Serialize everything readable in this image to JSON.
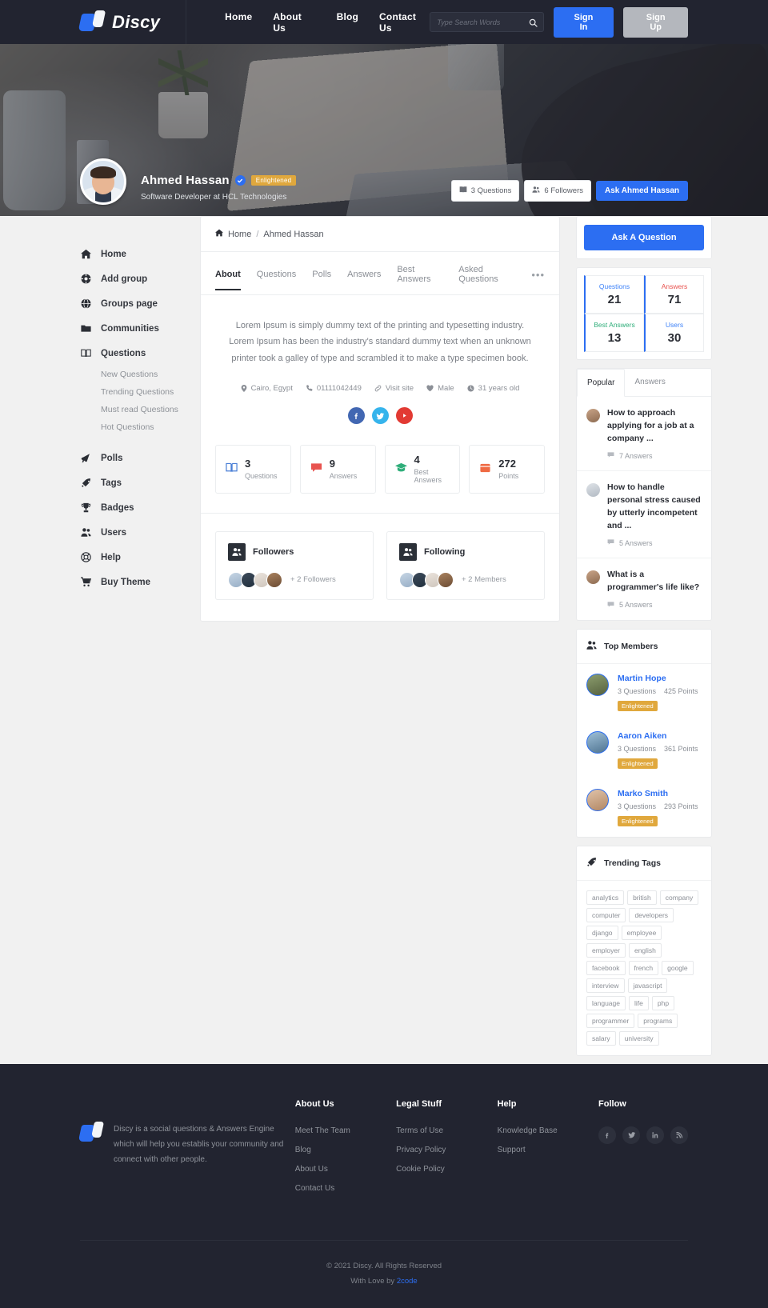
{
  "header": {
    "brand": "Discy",
    "nav": [
      {
        "label": "Home"
      },
      {
        "label": "About Us"
      },
      {
        "label": "Blog"
      },
      {
        "label": "Contact Us"
      }
    ],
    "search_placeholder": "Type Search Words",
    "search_value": "",
    "sign_in": "Sign In",
    "sign_up": "Sign Up"
  },
  "hero": {
    "name": "Ahmed Hassan",
    "badge": "Enlightened",
    "subtitle": "Software Developer at HCL Technologies",
    "questions_pill": "3 Questions",
    "followers_pill": "6 Followers",
    "ask_button": "Ask Ahmed Hassan"
  },
  "sidebar": {
    "items": [
      {
        "label": "Home",
        "icon": "home-icon"
      },
      {
        "label": "Add group",
        "icon": "add-group-icon"
      },
      {
        "label": "Groups page",
        "icon": "globe-icon"
      },
      {
        "label": "Communities",
        "icon": "folder-icon"
      },
      {
        "label": "Questions",
        "icon": "book-icon"
      }
    ],
    "question_subitems": [
      {
        "label": "New Questions"
      },
      {
        "label": "Trending Questions"
      },
      {
        "label": "Must read Questions"
      },
      {
        "label": "Hot Questions"
      }
    ],
    "items2": [
      {
        "label": "Polls",
        "icon": "megaphone-icon"
      },
      {
        "label": "Tags",
        "icon": "tag-icon"
      },
      {
        "label": "Badges",
        "icon": "trophy-icon"
      },
      {
        "label": "Users",
        "icon": "users-icon"
      },
      {
        "label": "Help",
        "icon": "lifebuoy-icon"
      },
      {
        "label": "Buy Theme",
        "icon": "cart-icon"
      }
    ]
  },
  "main": {
    "breadcrumb": {
      "home": "Home",
      "separator": "/",
      "current": "Ahmed Hassan"
    },
    "tabs": [
      {
        "label": "About",
        "active": true
      },
      {
        "label": "Questions",
        "active": false
      },
      {
        "label": "Polls",
        "active": false
      },
      {
        "label": "Answers",
        "active": false
      },
      {
        "label": "Best Answers",
        "active": false
      },
      {
        "label": "Asked Questions",
        "active": false
      }
    ],
    "tabs_more": "•••",
    "bio": "Lorem Ipsum is simply dummy text of the printing and typesetting industry. Lorem Ipsum has been the industry's standard dummy text when an unknown printer took a galley of type and scrambled it to make a type specimen book.",
    "meta": [
      {
        "icon": "location-pin-icon",
        "label": "Cairo, Egypt"
      },
      {
        "icon": "phone-icon",
        "label": "01111042449"
      },
      {
        "icon": "link-icon",
        "label": "Visit site"
      },
      {
        "icon": "heart-icon",
        "label": "Male"
      },
      {
        "icon": "clock-icon",
        "label": "31 years old"
      }
    ],
    "socials": [
      {
        "name": "facebook-icon",
        "color": "#4267b2"
      },
      {
        "name": "twitter-icon",
        "color": "#36b4ec"
      },
      {
        "name": "youtube-icon",
        "color": "#e23a33"
      }
    ],
    "stats": [
      {
        "value": "3",
        "label": "Questions",
        "icon": "book-icon",
        "color": "#4a7fd6"
      },
      {
        "value": "9",
        "label": "Answers",
        "icon": "comment-icon",
        "color": "#e8534f"
      },
      {
        "value": "4",
        "label": "Best Answers",
        "icon": "graduation-icon",
        "color": "#2fae7a"
      },
      {
        "value": "272",
        "label": "Points",
        "icon": "award-icon",
        "color": "#ef6a43"
      }
    ],
    "followers": {
      "title": "Followers",
      "more": "+ 2 Followers"
    },
    "following": {
      "title": "Following",
      "more": "+ 2 Members"
    }
  },
  "rail": {
    "ask_question": "Ask A Question",
    "counters": [
      {
        "label": "Questions",
        "value": "21",
        "color": "#3f83f8"
      },
      {
        "label": "Answers",
        "value": "71",
        "color": "#e8534f"
      },
      {
        "label": "Best Answers",
        "value": "13",
        "color": "#2fae7a"
      },
      {
        "label": "Users",
        "value": "30",
        "color": "#3f83f8"
      }
    ],
    "pq_tabs": [
      {
        "label": "Popular",
        "active": true
      },
      {
        "label": "Answers",
        "active": false
      }
    ],
    "popular_questions": [
      {
        "title": "How to approach applying for a job at a company ...",
        "answers": "7 Answers"
      },
      {
        "title": "How to handle personal stress caused by utterly incompetent and ...",
        "answers": "5 Answers"
      },
      {
        "title": "What is a programmer's life like?",
        "answers": "5 Answers"
      }
    ],
    "top_members_title": "Top Members",
    "top_members": [
      {
        "name": "Martin Hope",
        "questions": "3 Questions",
        "points": "425 Points",
        "badge": "Enlightened"
      },
      {
        "name": "Aaron Aiken",
        "questions": "3 Questions",
        "points": "361 Points",
        "badge": "Enlightened"
      },
      {
        "name": "Marko Smith",
        "questions": "3 Questions",
        "points": "293 Points",
        "badge": "Enlightened"
      }
    ],
    "trending_tags_title": "Trending Tags",
    "tags": [
      "analytics",
      "british",
      "company",
      "computer",
      "developers",
      "django",
      "employee",
      "employer",
      "english",
      "facebook",
      "french",
      "google",
      "interview",
      "javascript",
      "language",
      "life",
      "php",
      "programmer",
      "programs",
      "salary",
      "university"
    ]
  },
  "footer": {
    "description": "Discy is a social questions & Answers Engine which will help you establis your community and connect with other people.",
    "columns": [
      {
        "title": "About Us",
        "links": [
          "Meet The Team",
          "Blog",
          "About Us",
          "Contact Us"
        ]
      },
      {
        "title": "Legal Stuff",
        "links": [
          "Terms of Use",
          "Privacy Policy",
          "Cookie Policy"
        ]
      },
      {
        "title": "Help",
        "links": [
          "Knowledge Base",
          "Support"
        ]
      }
    ],
    "follow_title": "Follow",
    "socials": [
      {
        "name": "facebook-icon"
      },
      {
        "name": "twitter-icon"
      },
      {
        "name": "linkedin-icon"
      },
      {
        "name": "rss-icon"
      }
    ],
    "copyright": "© 2021 Discy. All Rights Reserved",
    "credit_prefix": "With Love by ",
    "credit_link": "2code"
  }
}
